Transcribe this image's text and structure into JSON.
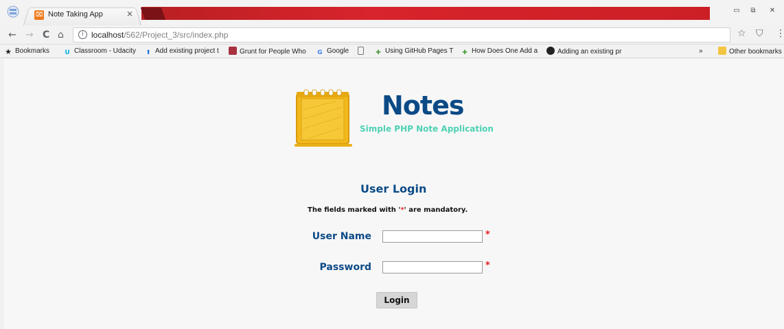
{
  "browser": {
    "tab": {
      "title": "Note Taking App",
      "close_glyph": "×",
      "favicon_glyph": "⌧"
    },
    "window_controls": {
      "minimize": "▭",
      "restore": "⧉",
      "close": "✕"
    },
    "nav": {
      "back": "←",
      "forward": "→",
      "reload": "C",
      "home": "⌂"
    },
    "address": {
      "host": "localhost",
      "path": "/562/Project_3/src/index.php",
      "info_glyph": "i"
    },
    "toolbar_right": {
      "star": "☆",
      "shield": "⛉",
      "menu": "⋮"
    },
    "bookmarks": {
      "label": "Bookmarks",
      "items": [
        "Classroom - Udacity",
        "Add existing project t",
        "Grunt for People Who",
        "Google",
        "",
        "Using GitHub Pages T",
        "How Does One Add a",
        "Adding an existing pr"
      ],
      "overflow": "»",
      "other": "Other bookmarks"
    }
  },
  "app": {
    "title": "Notes",
    "subtitle": "Simple PHP Note Application"
  },
  "login": {
    "heading": "User Login",
    "note_prefix": "The fields marked with '",
    "note_star": "*",
    "note_suffix": "' are mandatory.",
    "username_label": "User Name",
    "username_value": "",
    "password_label": "Password",
    "password_value": "",
    "required_mark": "*",
    "submit_label": "Login"
  },
  "colors": {
    "heading": "#0b4a86",
    "accent": "#4ed2b4",
    "required": "#e21c1c",
    "notepad": "#f2b81c"
  }
}
